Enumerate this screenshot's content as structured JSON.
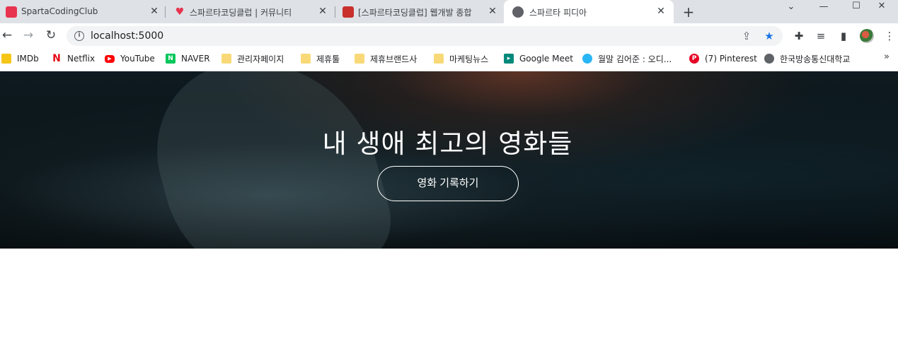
{
  "browser": {
    "tabs": [
      {
        "title": "SpartaCodingClub",
        "favicon": "sparta-icon",
        "active": false
      },
      {
        "title": "스파르타코딩클럽 | 커뮤니티",
        "favicon": "heart-icon",
        "active": false
      },
      {
        "title": "[스파르타코딩클럽] 웹개발 종합",
        "favicon": "book-icon",
        "active": false
      },
      {
        "title": "스파르타 피디아",
        "favicon": "globe-icon",
        "active": true
      }
    ],
    "new_tab": "+",
    "window_controls": {
      "dropdown": "⌄",
      "minimize": "—",
      "maximize": "☐",
      "close": "✕"
    },
    "address": {
      "url": "localhost:5000"
    },
    "bookmarks": [
      {
        "label": "IMDb",
        "icon": "imdb-icon"
      },
      {
        "label": "Netflix",
        "icon": "netflix-icon"
      },
      {
        "label": "YouTube",
        "icon": "youtube-icon"
      },
      {
        "label": "NAVER",
        "icon": "naver-icon"
      },
      {
        "label": "관리자페이지",
        "icon": "folder-icon"
      },
      {
        "label": "제휴툴",
        "icon": "folder-icon"
      },
      {
        "label": "제휴브랜드사",
        "icon": "folder-icon"
      },
      {
        "label": "마케팅뉴스",
        "icon": "folder-icon"
      },
      {
        "label": "Google Meet",
        "icon": "meet-icon"
      },
      {
        "label": "월말 김어준 : 오디...",
        "icon": "podcast-icon"
      },
      {
        "label": "(7) Pinterest",
        "icon": "pinterest-icon"
      },
      {
        "label": "한국방송통신대학교",
        "icon": "globe-icon"
      }
    ],
    "bookmarks_more": "»"
  },
  "hero": {
    "title": "내 생애 최고의 영화들",
    "button_label": "영화 기록하기"
  },
  "colors": {
    "tabstrip": "#dee1e6",
    "accent_star": "#1a73e8",
    "hero_dark": "#0a1418"
  }
}
